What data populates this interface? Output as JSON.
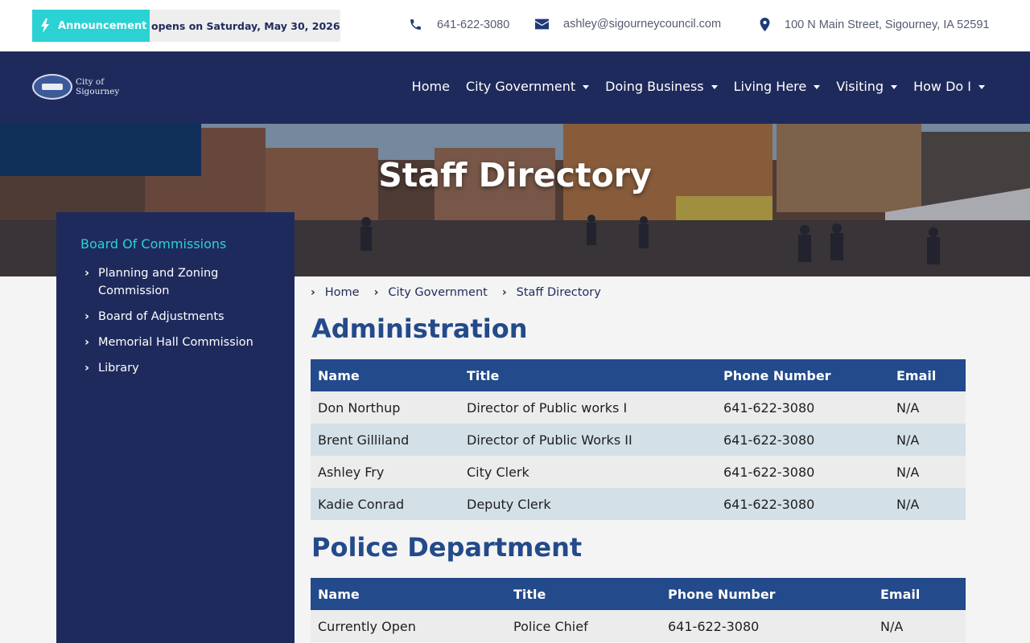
{
  "topbar": {
    "announcement_label": "Announcement",
    "announcement_text": "opens on Saturday, May 30, 2026!!",
    "phone": "641-622-3080",
    "email": "ashley@sigourneycouncil.com",
    "address": "100 N Main Street, Sigourney, IA 52591"
  },
  "header": {
    "logo_line1": "City of",
    "logo_line2": "Sigourney",
    "nav": [
      {
        "label": "Home",
        "dropdown": false
      },
      {
        "label": "City Government",
        "dropdown": true
      },
      {
        "label": "Doing Business",
        "dropdown": true
      },
      {
        "label": "Living Here",
        "dropdown": true
      },
      {
        "label": "Visiting",
        "dropdown": true
      },
      {
        "label": "How Do I",
        "dropdown": true
      }
    ]
  },
  "hero": {
    "title": "Staff Directory"
  },
  "sidebar": {
    "heading": "Board Of Commissions",
    "items": [
      {
        "label": "Planning and Zoning Commission"
      },
      {
        "label": "Board of Adjustments"
      },
      {
        "label": "Memorial Hall Commission"
      },
      {
        "label": "Library"
      }
    ]
  },
  "breadcrumb": [
    "Home",
    "City Government",
    "Staff Directory"
  ],
  "sections": [
    {
      "title": "Administration",
      "columns": [
        "Name",
        "Title",
        "Phone Number",
        "Email"
      ],
      "rows": [
        [
          "Don Northup",
          "Director of Public works I",
          "641-622-3080",
          "N/A"
        ],
        [
          "Brent Gilliland",
          "Director of Public Works II",
          "641-622-3080",
          "N/A"
        ],
        [
          "Ashley Fry",
          "City Clerk",
          "641-622-3080",
          "N/A"
        ],
        [
          "Kadie Conrad",
          "Deputy Clerk",
          "641-622-3080",
          "N/A"
        ]
      ]
    },
    {
      "title": "Police Department",
      "columns": [
        "Name",
        "Title",
        "Phone Number",
        "Email"
      ],
      "rows": [
        [
          "Currently Open",
          "Police Chief",
          "641-622-3080",
          "N/A"
        ]
      ]
    }
  ],
  "colors": {
    "navy": "#1f2a5c",
    "accent_teal": "#2ad2d4",
    "table_header": "#234a8a",
    "row_odd": "#ececec",
    "row_even": "#d3e0e8"
  }
}
